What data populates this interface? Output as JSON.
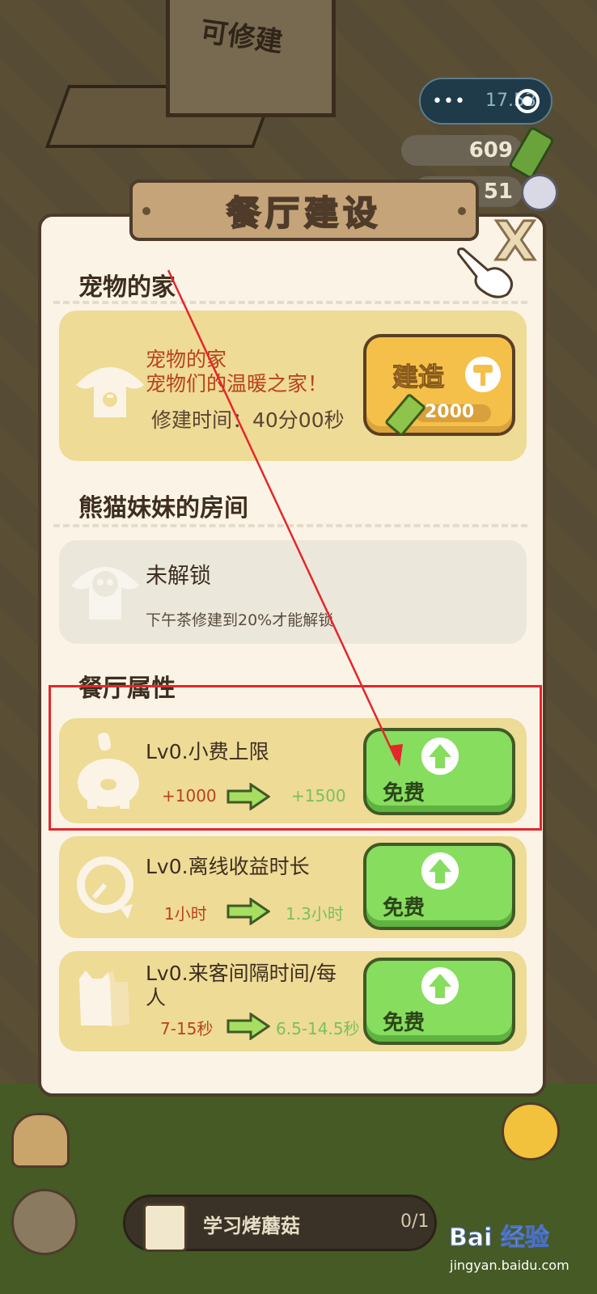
{
  "background": {
    "building_label": "可修建"
  },
  "hud": {
    "faint_value": "17.53",
    "bamboo_count": "609",
    "pearl_count": "51"
  },
  "modal": {
    "title": "餐厅建设",
    "close": "X",
    "sections": {
      "pet_home": "宠物的家",
      "panda_room": "熊猫妹妹的房间",
      "attributes": "餐厅属性"
    },
    "pet_home_card": {
      "name": "宠物的家",
      "description": "宠物们的温暖之家！",
      "build_time": "修建时间：40分00秒",
      "build_label": "建造",
      "cost": "2000"
    },
    "panda_room_card": {
      "status": "未解锁",
      "requirement": "下午茶修建到20%才能解锁"
    },
    "attribute_cards": [
      {
        "name": "Lv0.小费上限",
        "current": "+1000",
        "next": "+1500",
        "button": "免费"
      },
      {
        "name": "Lv0.离线收益时长",
        "current": "1小时",
        "next": "1.3小时",
        "button": "免费"
      },
      {
        "name_line1": "Lv0.来客间隔时间/每",
        "name_line2": "人",
        "current": "7-15秒",
        "next": "6.5-14.5秒",
        "button": "免费"
      }
    ]
  },
  "bottom": {
    "task_label": "学习烤蘑菇",
    "task_progress": "0/1"
  },
  "watermark": {
    "brand": "Bai 经验",
    "url": "jingyan.baidu.com"
  },
  "colors": {
    "accent_gold": "#eedb96",
    "free_green": "#86dd5e",
    "annotation_red": "#e5262a"
  }
}
